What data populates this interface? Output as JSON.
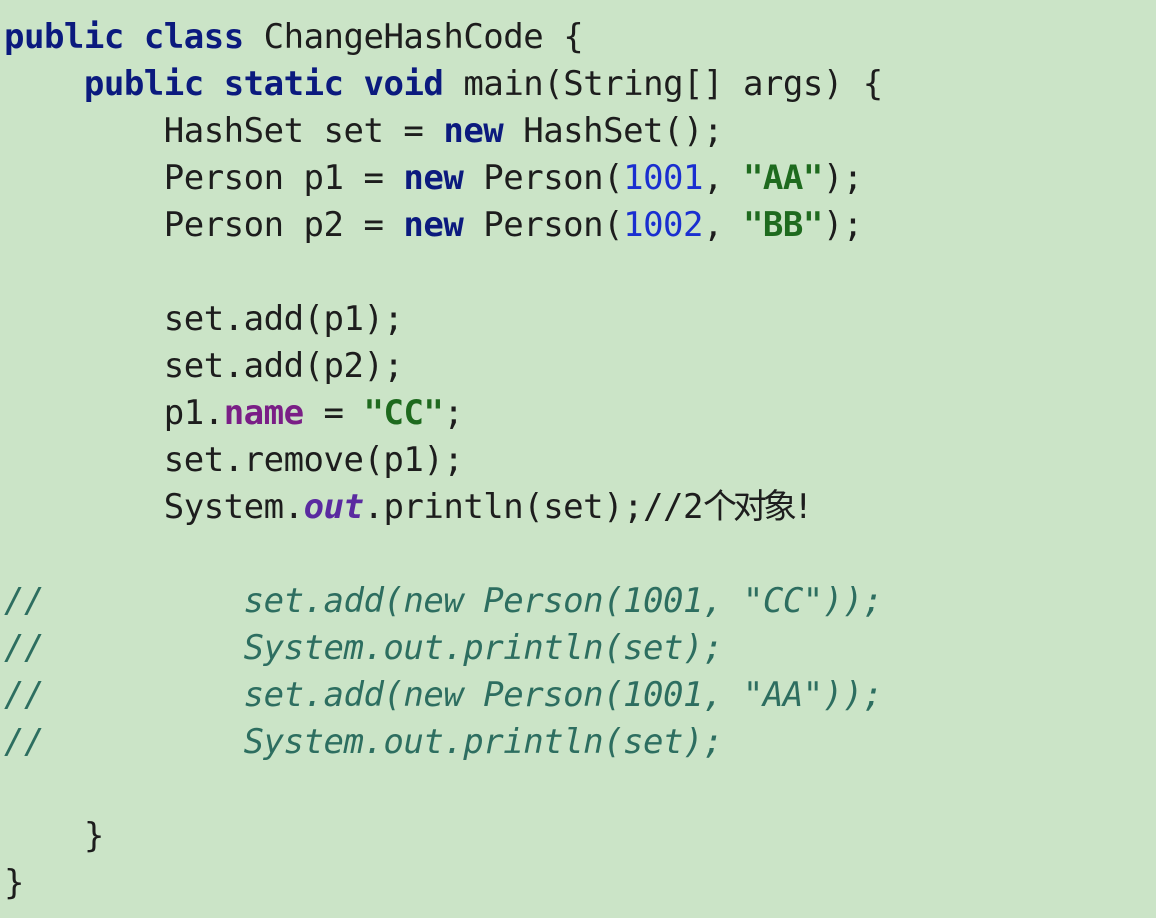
{
  "code_view": {
    "lines": {
      "l1": {
        "kw1": "public",
        "kw2": "class",
        "text": " ChangeHashCode {"
      },
      "l2": {
        "indent": "    ",
        "kw1": "public",
        "kw2": "static",
        "kw3": "void",
        "text": " main(String[] args) {"
      },
      "l3": {
        "indent": "        ",
        "a": "HashSet set = ",
        "kw": "new",
        "b": " HashSet();"
      },
      "l4": {
        "indent": "        ",
        "a": "Person p1 = ",
        "kw": "new",
        "b": " Person(",
        "num": "1001",
        "c": ", ",
        "str": "\"AA\"",
        "d": ");"
      },
      "l5": {
        "indent": "        ",
        "a": "Person p2 = ",
        "kw": "new",
        "b": " Person(",
        "num": "1002",
        "c": ", ",
        "str": "\"BB\"",
        "d": ");"
      },
      "l6": {
        "text": ""
      },
      "l7": {
        "indent": "        ",
        "text": "set.add(p1);"
      },
      "l8": {
        "indent": "        ",
        "text": "set.add(p2);"
      },
      "l9": {
        "indent": "        ",
        "a": "p1.",
        "field": "name",
        "b": " = ",
        "str": "\"CC\"",
        "c": ";"
      },
      "l10": {
        "indent": "        ",
        "text": "set.remove(p1);"
      },
      "l11": {
        "indent": "        ",
        "a": "System.",
        "field": "out",
        "b": ".println(set);//2",
        "cn": "个对象",
        "c": "!"
      },
      "l12": {
        "text": ""
      },
      "l13": {
        "text": "//          set.add(new Person(1001, \"CC\"));"
      },
      "l14": {
        "text": "//          System.out.println(set);"
      },
      "l15": {
        "text": "//          set.add(new Person(1001, \"AA\"));"
      },
      "l16": {
        "text": "//          System.out.println(set);"
      },
      "l17": {
        "text": ""
      },
      "l18": {
        "indent": "    ",
        "text": "}"
      },
      "l19": {
        "text": "}"
      }
    }
  }
}
